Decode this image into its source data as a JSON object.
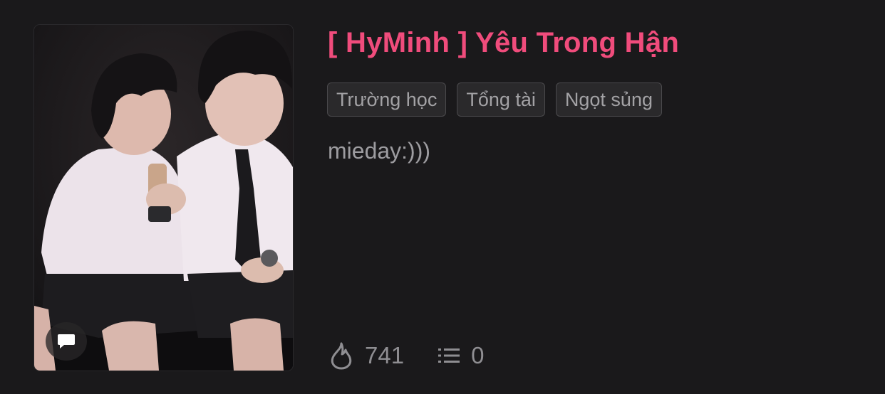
{
  "story": {
    "title": "[ HyMinh ] Yêu Trong Hận",
    "tags": [
      {
        "label": "Trường học"
      },
      {
        "label": "Tổng tài"
      },
      {
        "label": "Ngọt sủng"
      }
    ],
    "description": "mieday:)))",
    "stats": {
      "views": "741",
      "chapters": "0"
    },
    "cover": {
      "icon": "chat-bubble-icon"
    }
  },
  "colors": {
    "background": "#1a191b",
    "title": "#f04c7c",
    "tag_bg": "#2a292b",
    "tag_border": "#4a494c",
    "muted_text": "#9d9ca0"
  }
}
